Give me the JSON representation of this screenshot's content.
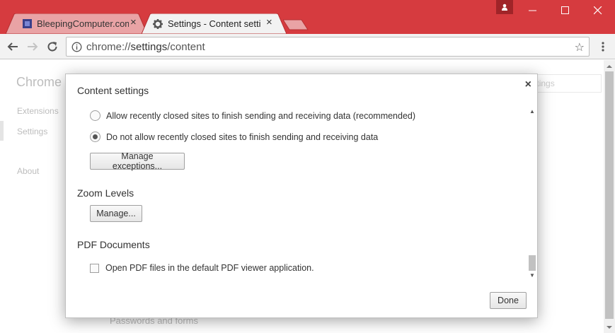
{
  "tabs": [
    {
      "title": "BleepingComputer.com -",
      "close": "×",
      "active": false
    },
    {
      "title": "Settings - Content settings",
      "close": "×",
      "active": true
    }
  ],
  "window": {
    "minimize": "—",
    "maximize": "☐",
    "close": "✕"
  },
  "omnibox": {
    "scheme": "chrome://",
    "host": "settings",
    "path": "/content",
    "star": "☆"
  },
  "background_page": {
    "heading": "Chrome",
    "nav": [
      "Extensions",
      "Settings",
      "About"
    ],
    "search_placeholder": "Search settings",
    "partial_item": "Passwords and forms"
  },
  "dialog": {
    "title": "Content settings",
    "close": "×",
    "radios": [
      {
        "label": "Allow recently closed sites to finish sending and receiving data (recommended)",
        "checked": false
      },
      {
        "label": "Do not allow recently closed sites to finish sending and receiving data",
        "checked": true
      }
    ],
    "manage_exceptions": "Manage exceptions...",
    "zoom_heading": "Zoom Levels",
    "zoom_manage": "Manage...",
    "pdf_heading": "PDF Documents",
    "pdf_checkbox": {
      "label": "Open PDF files in the default PDF viewer application.",
      "checked": false
    },
    "done": "Done"
  },
  "colors": {
    "titlebar": "#d63b3f",
    "toolbar": "#f2f2f2"
  }
}
